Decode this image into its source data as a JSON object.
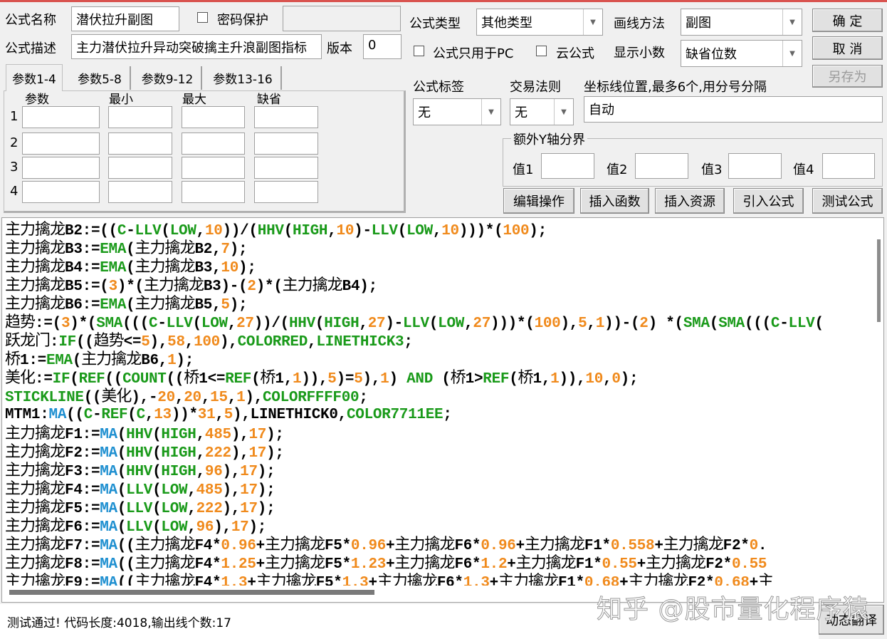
{
  "form": {
    "name_label": "公式名称",
    "name_value": "潜伏拉升副图",
    "password_label": "密码保护",
    "password_value": "",
    "desc_label": "公式描述",
    "desc_value": "主力潜伏拉升异动突破擒主升浪副图指标",
    "version_label": "版本",
    "version_value": "0",
    "type_label": "公式类型",
    "type_value": "其他类型",
    "draw_label": "画线方法",
    "draw_value": "副图",
    "pc_only_label": "公式只用于PC",
    "cloud_label": "云公式",
    "decimal_label": "显示小数",
    "decimal_value": "缺省位数",
    "tag_label": "公式标签",
    "tag_value": "无",
    "rule_label": "交易法则",
    "rule_value": "无",
    "axis_label": "坐标线位置,最多6个,用分号分隔",
    "axis_value": "自动",
    "yaxis_group": "额外Y轴分界",
    "yvals": [
      "值1",
      "值2",
      "值3",
      "值4"
    ]
  },
  "buttons": {
    "ok": "确  定",
    "cancel": "取  消",
    "save_as": "另存为",
    "edit": "编辑操作",
    "insert_func": "插入函数",
    "insert_res": "插入资源",
    "import": "引入公式",
    "test": "测试公式",
    "translate": "动态翻译"
  },
  "params": {
    "tabs": [
      "参数1-4",
      "参数5-8",
      "参数9-12",
      "参数13-16"
    ],
    "headers": [
      "参数",
      "最小",
      "最大",
      "缺省"
    ],
    "rows": [
      "1",
      "2",
      "3",
      "4"
    ]
  },
  "syntax": {
    "func_color": "#1a9a1a",
    "ma_color": "#1e8fd0",
    "num_color": "#f08a1c",
    "text_color": "#000000",
    "green_words": [
      "C",
      "LLV",
      "LOW",
      "HHV",
      "HIGH",
      "EMA",
      "SMA",
      "IF",
      "REF",
      "COUNT",
      "AND",
      "STICKLINE",
      "COLORRED",
      "LINETHICK3",
      "COLORFFFF00",
      "COLOR7711EE"
    ],
    "blue_words": [
      "MA"
    ]
  },
  "code_lines": [
    "主力擒龙B2:=((C-LLV(LOW,10))/(HHV(HIGH,10)-LLV(LOW,10)))*(100);",
    "主力擒龙B3:=EMA(主力擒龙B2,7);",
    "主力擒龙B4:=EMA(主力擒龙B3,10);",
    "主力擒龙B5:=(3)*(主力擒龙B3)-(2)*(主力擒龙B4);",
    "主力擒龙B6:=EMA(主力擒龙B5,5);",
    "趋势:=(3)*(SMA(((C-LLV(LOW,27))/(HHV(HIGH,27)-LLV(LOW,27)))*(100),5,1))-(2) *(SMA(SMA(((C-LLV(",
    "跃龙门:IF((趋势<=5),58,100),COLORRED,LINETHICK3;",
    "桥1:=EMA(主力擒龙B6,1);",
    "美化:=IF(REF((COUNT((桥1<=REF(桥1,1)),5)=5),1) AND (桥1>REF(桥1,1)),10,0);",
    "STICKLINE((美化),-20,20,15,1),COLORFFFF00;",
    "MTM1:MA((C-REF(C,13))*31,5),LINETHICK0,COLOR7711EE;",
    "主力擒龙F1:=MA(HHV(HIGH,485),17);",
    "主力擒龙F2:=MA(HHV(HIGH,222),17);",
    "主力擒龙F3:=MA(HHV(HIGH,96),17);",
    "主力擒龙F4:=MA(LLV(LOW,485),17);",
    "主力擒龙F5:=MA(LLV(LOW,222),17);",
    "主力擒龙F6:=MA(LLV(LOW,96),17);",
    "主力擒龙F7:=MA((主力擒龙F4*0.96+主力擒龙F5*0.96+主力擒龙F6*0.96+主力擒龙F1*0.558+主力擒龙F2*0.",
    "主力擒龙F8:=MA((主力擒龙F4*1.25+主力擒龙F5*1.23+主力擒龙F6*1.2+主力擒龙F1*0.55+主力擒龙F2*0.55",
    "主力擒龙F9:=MA((主力擒龙F4*1.3+主力擒龙F5*1.3+主力擒龙F6*1.3+主力擒龙F1*0.68+主力擒龙F2*0.68+主"
  ],
  "status": "测试通过! 代码长度:4018,输出线个数:17",
  "watermark": "知乎 @股市量化程序猿"
}
